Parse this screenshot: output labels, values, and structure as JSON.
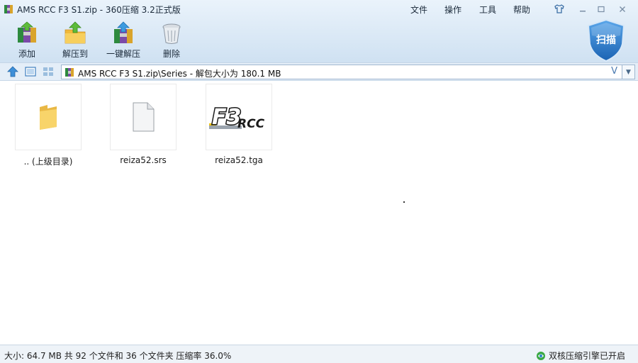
{
  "window": {
    "title": "AMS RCC F3 S1.zip - 360压缩 3.2正式版"
  },
  "menu": [
    {
      "label": "文件"
    },
    {
      "label": "操作"
    },
    {
      "label": "工具"
    },
    {
      "label": "帮助"
    }
  ],
  "toolbar": {
    "add_label": "添加",
    "extract_to_label": "解压到",
    "one_click_extract_label": "一键解压",
    "delete_label": "删除",
    "scan_label": "扫描"
  },
  "address": {
    "path": "AMS RCC F3 S1.zip\\Series - 解包大小为 180.1 MB",
    "check_glyph": "V"
  },
  "files": [
    {
      "name": ".. (上级目录)",
      "icon": "folder-icon"
    },
    {
      "name": "reiza52.srs",
      "icon": "file-icon"
    },
    {
      "name": "reiza52.tga",
      "icon": "f3-rcc-logo-thumbnail"
    }
  ],
  "status": {
    "summary": "大小: 64.7 MB 共 92 个文件和 36 个文件夹 压缩率 36.0%",
    "engine": "双核压缩引擎已开启"
  },
  "thumb_logo": {
    "f3": "F3",
    "rcc": "RCC"
  },
  "colors": {
    "accent": "#2f7fd1",
    "toolbar_bg": "#dbe9f6",
    "shield": "#1f6fc0"
  }
}
